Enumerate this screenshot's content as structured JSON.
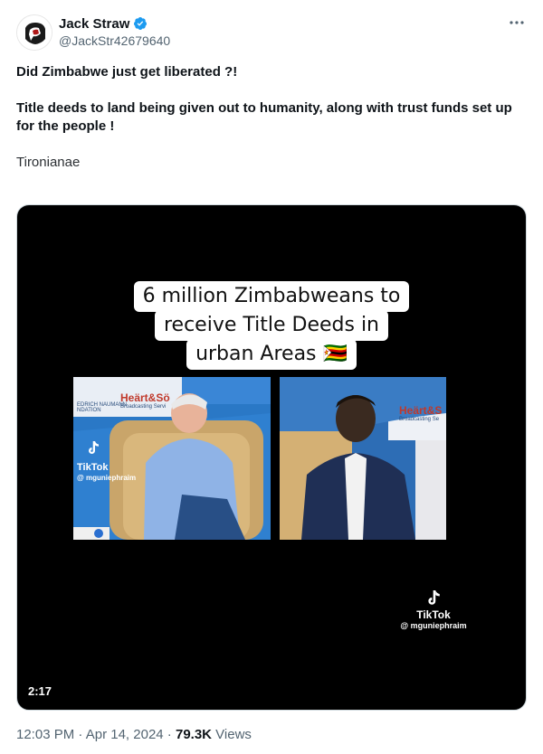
{
  "author": {
    "display_name": "Jack Straw",
    "handle": "@JackStr42679640",
    "verified": true
  },
  "tweet": {
    "line1": "Did Zimbabwe just get liberated ?!",
    "line2": "Title deeds to land being given out to humanity, along with trust funds set up for the people !",
    "line3": "Tironianae"
  },
  "media": {
    "caption_lines": [
      "6 million Zimbabweans to",
      "receive Title Deeds in",
      "urban Areas 🇿🇼"
    ],
    "left_frame": {
      "backdrop_text_1": "Heärt&Sö",
      "backdrop_text_2": "Broadcasting Servi",
      "backdrop_text_3": "EDRICH NAUMANN\nNDATION",
      "tiktok_label": "TikTok",
      "tiktok_user": "@ mguniephraim"
    },
    "right_frame": {
      "backdrop_text_1": "Heärt&S",
      "backdrop_text_2": "Broadcasting Se"
    },
    "tiktok_label": "TikTok",
    "tiktok_user": "@ mguniephraim",
    "duration": "2:17"
  },
  "meta": {
    "time": "12:03 PM",
    "separator": " · ",
    "date": "Apr 14, 2024",
    "views_count": "79.3K",
    "views_label": " Views"
  },
  "colors": {
    "accent_verified": "#1d9bf0",
    "muted_text": "#536471",
    "media_bg": "#000000"
  },
  "icons": [
    "avatar-logo",
    "verified-badge-icon",
    "more-icon",
    "tiktok-icon"
  ]
}
